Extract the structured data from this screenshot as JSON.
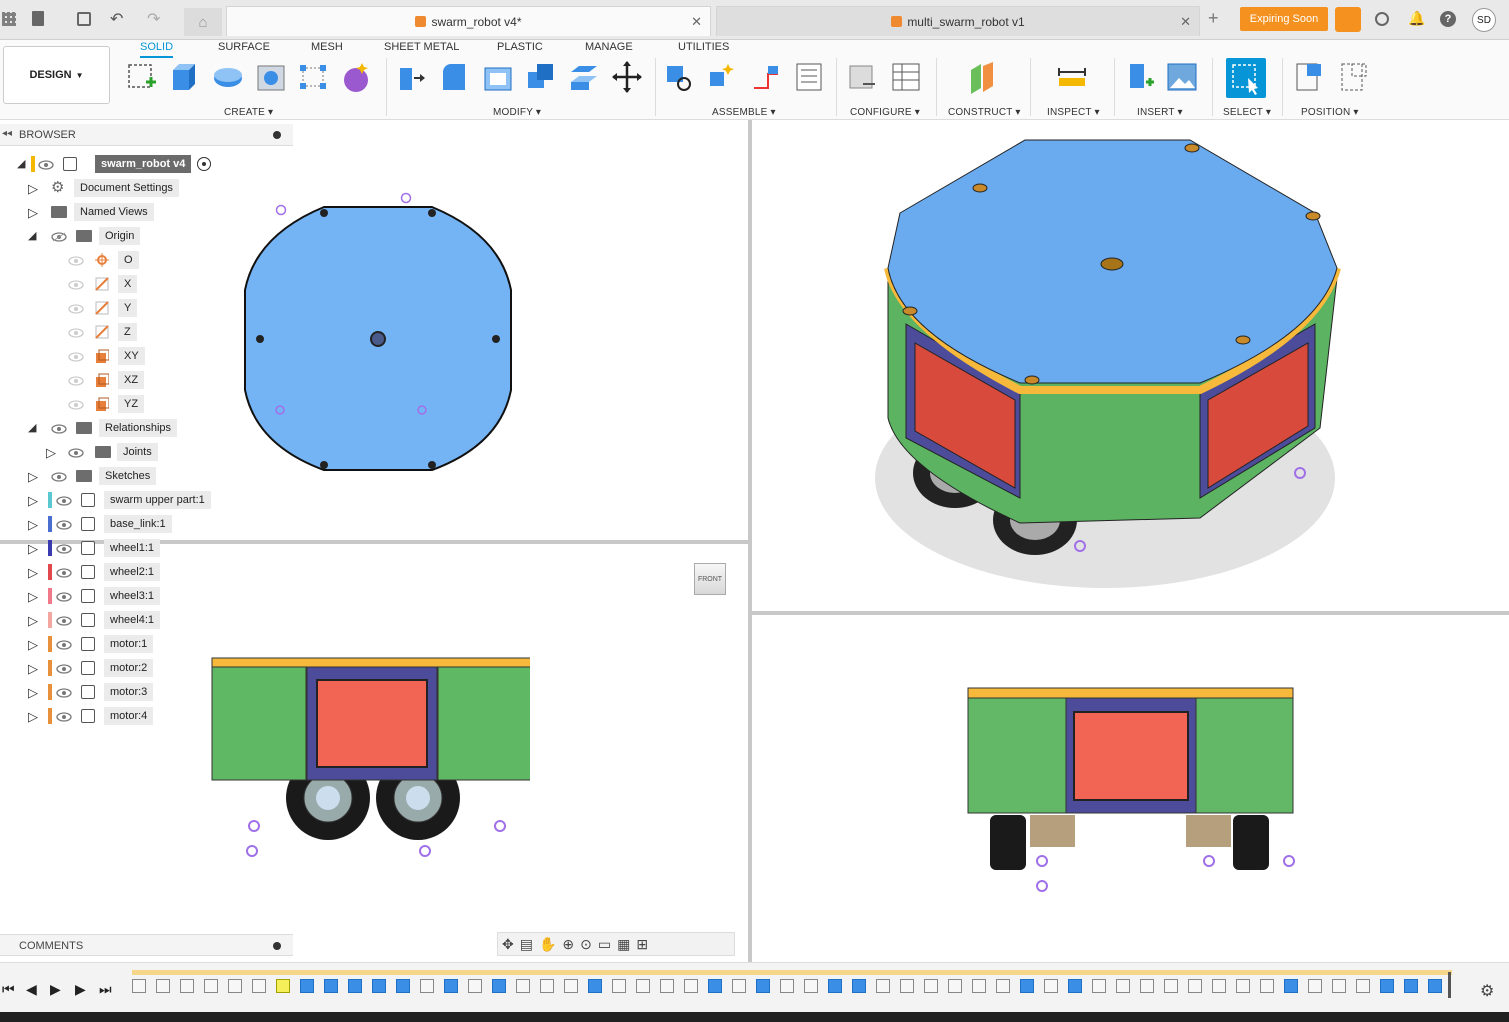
{
  "tabs": [
    {
      "label": "swarm_robot v4*",
      "active": true
    },
    {
      "label": "multi_swarm_robot v1",
      "active": false
    }
  ],
  "header": {
    "expiring": "Expiring Soon",
    "user_initials": "SD"
  },
  "workspace": {
    "label": "DESIGN"
  },
  "ribbon_tabs": [
    "SOLID",
    "SURFACE",
    "MESH",
    "SHEET METAL",
    "PLASTIC",
    "MANAGE",
    "UTILITIES"
  ],
  "groups": [
    "CREATE",
    "MODIFY",
    "ASSEMBLE",
    "CONFIGURE",
    "CONSTRUCT",
    "INSPECT",
    "INSERT",
    "SELECT",
    "POSITION"
  ],
  "browser": {
    "title": "BROWSER",
    "root": "swarm_robot v4",
    "items": [
      "Document Settings",
      "Named Views",
      "Origin",
      "O",
      "X",
      "Y",
      "Z",
      "XY",
      "XZ",
      "YZ",
      "Relationships",
      "Joints",
      "Sketches",
      "swarm upper part:1",
      "base_link:1",
      "wheel1:1",
      "wheel2:1",
      "wheel3:1",
      "wheel4:1",
      "motor:1",
      "motor:2",
      "motor:3",
      "motor:4"
    ]
  },
  "viewcube": {
    "label": "FRONT"
  },
  "comments": {
    "label": "COMMENTS"
  },
  "colors": {
    "accent": "#0696d7",
    "expiring": "#f5911f",
    "top": "#6aabf0",
    "green": "#62b866",
    "red": "#e35a48",
    "navy": "#4c4c9a",
    "rim": "#f6b93b"
  }
}
